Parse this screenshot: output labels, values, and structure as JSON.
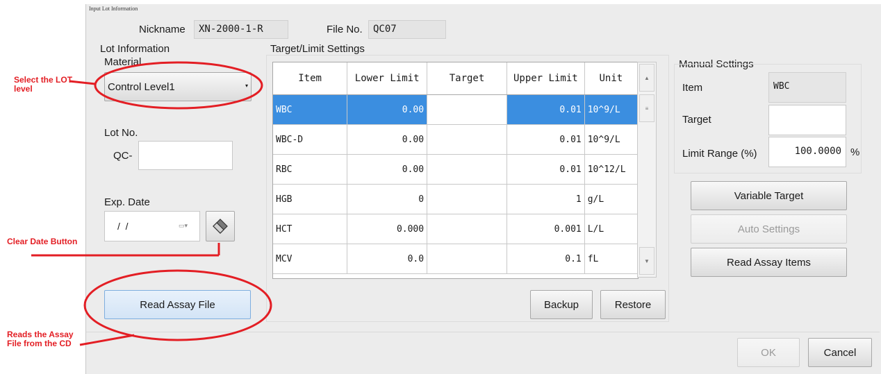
{
  "window": {
    "title": "Input Lot Information"
  },
  "header": {
    "nickname_label": "Nickname",
    "nickname_value": "XN-2000-1-R",
    "fileno_label": "File No.",
    "fileno_value": "QC07"
  },
  "lot": {
    "section_label": "Lot Information",
    "material_label": "Material",
    "material_value": "Control Level1",
    "lotno_label": "Lot No.",
    "lotno_prefix": "QC-",
    "lotno_value": "",
    "expdate_label": "Exp. Date",
    "expdate_value": "/  /",
    "read_assay_file": "Read Assay File"
  },
  "target": {
    "section_label": "Target/Limit Settings",
    "columns": [
      "Item",
      "Lower Limit",
      "Target",
      "Upper Limit",
      "Unit"
    ],
    "rows": [
      {
        "item": "WBC",
        "lower": "0.00",
        "target": "",
        "upper": "0.01",
        "unit": "10^9/L"
      },
      {
        "item": "WBC-D",
        "lower": "0.00",
        "target": "",
        "upper": "0.01",
        "unit": "10^9/L"
      },
      {
        "item": "RBC",
        "lower": "0.00",
        "target": "",
        "upper": "0.01",
        "unit": "10^12/L"
      },
      {
        "item": "HGB",
        "lower": "0",
        "target": "",
        "upper": "1",
        "unit": "g/L"
      },
      {
        "item": "HCT",
        "lower": "0.000",
        "target": "",
        "upper": "0.001",
        "unit": "L/L"
      },
      {
        "item": "MCV",
        "lower": "0.0",
        "target": "",
        "upper": "0.1",
        "unit": "fL"
      }
    ],
    "selected_row": "WBC",
    "backup": "Backup",
    "restore": "Restore"
  },
  "manual": {
    "section_label": "Manual Settings",
    "item_label": "Item",
    "item_value": "WBC",
    "target_label": "Target",
    "target_value": "",
    "limit_label": "Limit Range (%)",
    "limit_value": "100.0000",
    "limit_unit": "%",
    "variable_target": "Variable Target",
    "auto_settings": "Auto Settings",
    "read_assay_items": "Read Assay Items"
  },
  "footer": {
    "ok": "OK",
    "cancel": "Cancel"
  },
  "annotations": {
    "select_lot": "Select the LOT level",
    "clear_date": "Clear Date Button",
    "reads_assay": "Reads the Assay File from the CD"
  },
  "colors": {
    "annotation": "#e31e24",
    "selection": "#3b8ee0"
  }
}
